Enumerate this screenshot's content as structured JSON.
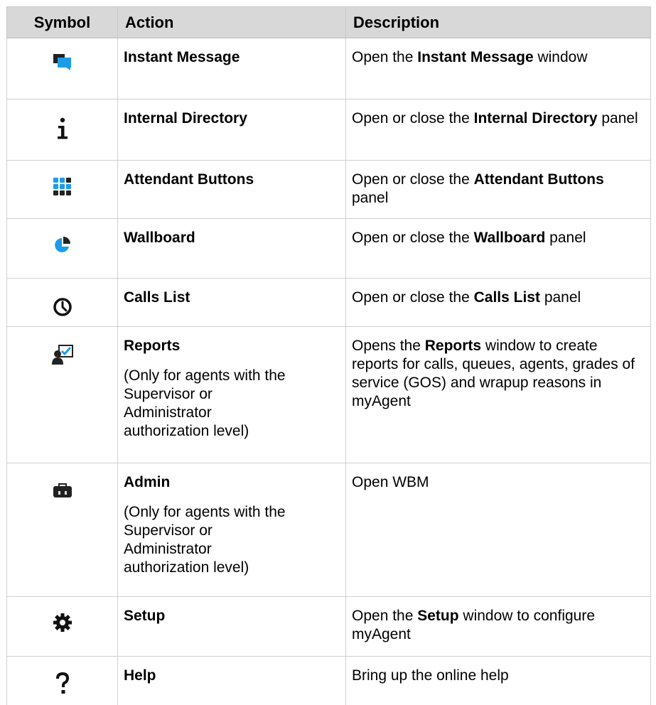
{
  "headers": {
    "symbol": "Symbol",
    "action": "Action",
    "description": "Description"
  },
  "colors": {
    "header_bg": "#d8d8d8",
    "accent_blue": "#1e9be9",
    "icon_dark": "#222222"
  },
  "rows": [
    {
      "icon": "instant-message-icon",
      "action": "Instant Message",
      "desc": {
        "pre": "Open the ",
        "bold": "Instant Message",
        "post": " window"
      }
    },
    {
      "icon": "info-icon",
      "action": "Internal Directory",
      "desc": {
        "pre": "Open or close the ",
        "bold": "Internal Directory",
        "post": " panel"
      }
    },
    {
      "icon": "attendant-buttons-grid-icon",
      "action": "Attendant Buttons",
      "desc": {
        "pre": "Open or close the ",
        "bold": "Attendant Buttons",
        "post": " panel"
      }
    },
    {
      "icon": "wallboard-pie-icon",
      "action": "Wallboard",
      "desc": {
        "pre": "Open or close the ",
        "bold": "Wallboard",
        "post": " panel"
      }
    },
    {
      "icon": "clock-icon",
      "action": "Calls List",
      "desc": {
        "pre": "Open or close the ",
        "bold": "Calls List",
        "post": " panel"
      }
    },
    {
      "icon": "reports-user-check-icon",
      "action": "Reports",
      "note": "(Only for agents with the Supervisor or Administrator authorization level)",
      "desc": {
        "pre": "Opens the ",
        "bold": "Reports",
        "post": " window to create reports for calls, queues, agents, grades of service (GOS) and wrapup reasons in myAgent"
      }
    },
    {
      "icon": "admin-toolbox-icon",
      "action": "Admin",
      "note": "(Only for agents with the Supervisor or Administrator authorization level)",
      "desc": {
        "pre": "Open WBM",
        "bold": "",
        "post": ""
      }
    },
    {
      "icon": "gear-icon",
      "action": "Setup",
      "desc": {
        "pre": "Open the ",
        "bold": "Setup",
        "post": " window to configure myAgent"
      }
    },
    {
      "icon": "question-mark-icon",
      "action": "Help",
      "desc": {
        "pre": "Bring up the online help",
        "bold": "",
        "post": ""
      }
    }
  ]
}
